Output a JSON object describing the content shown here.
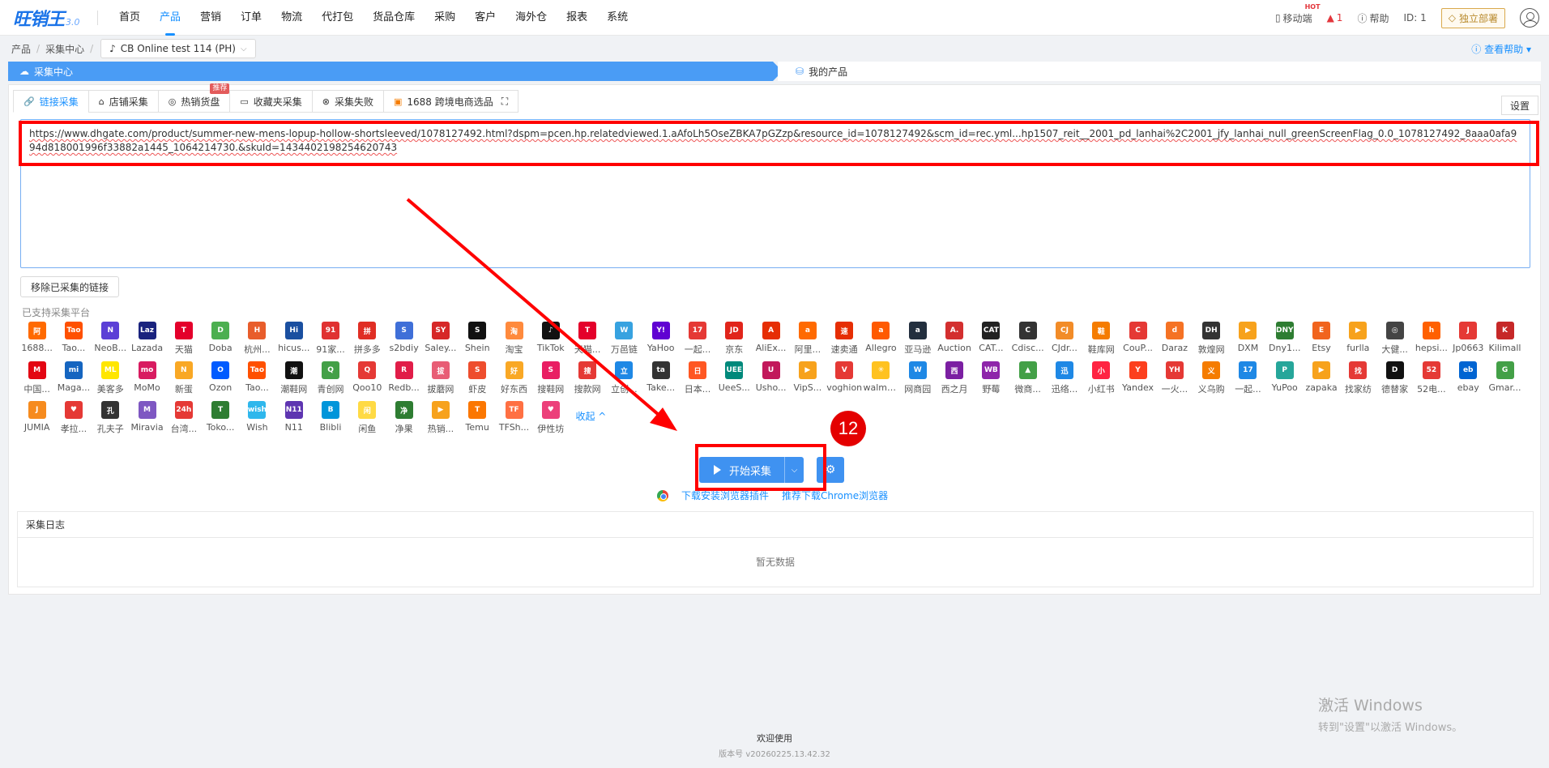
{
  "brand": {
    "name": "旺销王",
    "version": "3.0"
  },
  "nav": {
    "items": [
      "首页",
      "产品",
      "营销",
      "订单",
      "物流",
      "代打包",
      "货品仓库",
      "采购",
      "客户",
      "海外仓",
      "报表",
      "系统"
    ],
    "active": "产品",
    "mobile": "移动端",
    "hot": "HOT",
    "alert_count": "1",
    "help": "帮助",
    "id_label": "ID: 1",
    "deploy": "独立部署"
  },
  "breadcrumb": {
    "items": [
      "产品",
      "采集中心"
    ],
    "shop": "CB Online test 114 (PH)",
    "help_link": "查看帮助"
  },
  "steps": {
    "current": "采集中心",
    "next": "我的产品"
  },
  "tabs": [
    {
      "label": "链接采集",
      "icon": "link-icon"
    },
    {
      "label": "店铺采集",
      "icon": "home-icon"
    },
    {
      "label": "热销货盘",
      "icon": "fire-icon",
      "badge": "推荐"
    },
    {
      "label": "收藏夹采集",
      "icon": "folder-icon"
    },
    {
      "label": "采集失败",
      "icon": "fail-icon"
    },
    {
      "label": "1688 跨境电商选品",
      "icon": "store-icon"
    }
  ],
  "settings_label": "设置",
  "url_input": "https://www.dhgate.com/product/summer-new-mens-lopup-hollow-shortsleeved/1078127492.html?dspm=pcen.hp.relatedviewed.1.aAfoLh5OseZBKA7pGZzp&resource_id=1078127492&scm_id=rec.yml...hp1507_reit__2001_pd_lanhai%2C2001_jfy_lanhai_null_greenScreenFlag_0.0_1078127492_8aaa0afa994d818001996f33882a1445_1064214730.&skuId=1434402198254620743",
  "remove_btn": "移除已采集的链接",
  "supported_label": "已支持采集平台",
  "platforms": [
    {
      "name": "1688...",
      "abbr": "阿",
      "color": "#ff6a00"
    },
    {
      "name": "Tao...",
      "abbr": "Tao",
      "color": "#ff5000"
    },
    {
      "name": "NeoB...",
      "abbr": "N",
      "color": "#5b3fd6"
    },
    {
      "name": "Lazada",
      "abbr": "Laz",
      "color": "#1a237e"
    },
    {
      "name": "天猫",
      "abbr": "T",
      "color": "#e4002b"
    },
    {
      "name": "Doba",
      "abbr": "D",
      "color": "#4caf50"
    },
    {
      "name": "杭州...",
      "abbr": "H",
      "color": "#e85d2b"
    },
    {
      "name": "hicus...",
      "abbr": "Hi",
      "color": "#1a4fa0"
    },
    {
      "name": "91家...",
      "abbr": "91",
      "color": "#e03131"
    },
    {
      "name": "拼多多",
      "abbr": "拼",
      "color": "#e02e24"
    },
    {
      "name": "s2bdiy",
      "abbr": "S",
      "color": "#3f6fd8"
    },
    {
      "name": "Saley...",
      "abbr": "SY",
      "color": "#d62828"
    },
    {
      "name": "Shein",
      "abbr": "S",
      "color": "#111111"
    },
    {
      "name": "淘宝",
      "abbr": "淘",
      "color": "#ff8a3d"
    },
    {
      "name": "TikTok",
      "abbr": "♪",
      "color": "#111111"
    },
    {
      "name": "天猫...",
      "abbr": "T",
      "color": "#e4002b"
    },
    {
      "name": "万邑链",
      "abbr": "W",
      "color": "#37a2e0"
    },
    {
      "name": "YaHoo",
      "abbr": "Y!",
      "color": "#6001d2"
    },
    {
      "name": "一起...",
      "abbr": "17",
      "color": "#e53935"
    },
    {
      "name": "京东",
      "abbr": "JD",
      "color": "#e1251b"
    },
    {
      "name": "AliEx...",
      "abbr": "A",
      "color": "#e62e04"
    },
    {
      "name": "阿里...",
      "abbr": "a",
      "color": "#ff6a00"
    },
    {
      "name": "速卖通",
      "abbr": "速",
      "color": "#e62e04"
    },
    {
      "name": "Allegro",
      "abbr": "a",
      "color": "#ff5a00"
    },
    {
      "name": "亚马逊",
      "abbr": "a",
      "color": "#232f3e"
    },
    {
      "name": "Auction",
      "abbr": "A.",
      "color": "#d32f2f"
    },
    {
      "name": "CAT...",
      "abbr": "CAT",
      "color": "#222222"
    },
    {
      "name": "Cdisc...",
      "abbr": "C",
      "color": "#333333"
    },
    {
      "name": "CJdr...",
      "abbr": "CJ",
      "color": "#f28c28"
    },
    {
      "name": "鞋库网",
      "abbr": "鞋",
      "color": "#f57c00"
    },
    {
      "name": "CouP...",
      "abbr": "C",
      "color": "#e53935"
    },
    {
      "name": "Daraz",
      "abbr": "d",
      "color": "#f57224"
    },
    {
      "name": "敦煌网",
      "abbr": "DH",
      "color": "#333333"
    },
    {
      "name": "DXM",
      "abbr": "▶",
      "color": "#f7a21c"
    },
    {
      "name": "Dny1...",
      "abbr": "DNY",
      "color": "#2e7d32"
    },
    {
      "name": "Etsy",
      "abbr": "E",
      "color": "#f1641e"
    },
    {
      "name": "furlla",
      "abbr": "▶",
      "color": "#f7a21c"
    },
    {
      "name": "大健...",
      "abbr": "◎",
      "color": "#444444"
    },
    {
      "name": "hepsi...",
      "abbr": "h",
      "color": "#ff6000"
    },
    {
      "name": "Jp0663",
      "abbr": "J",
      "color": "#e53935"
    },
    {
      "name": "Kilimall",
      "abbr": "K",
      "color": "#c62828"
    },
    {
      "name": "中国...",
      "abbr": "M",
      "color": "#e30613"
    },
    {
      "name": "Maga...",
      "abbr": "mi",
      "color": "#1565c0"
    },
    {
      "name": "美客多",
      "abbr": "ML",
      "color": "#ffe600"
    },
    {
      "name": "MoMo",
      "abbr": "mo",
      "color": "#d81b60"
    },
    {
      "name": "新蛋",
      "abbr": "N",
      "color": "#f9a825"
    },
    {
      "name": "Ozon",
      "abbr": "O",
      "color": "#005bff"
    },
    {
      "name": "Tao...",
      "abbr": "Tao",
      "color": "#ff5000"
    },
    {
      "name": "潮鞋网",
      "abbr": "潮",
      "color": "#111111"
    },
    {
      "name": "青创网",
      "abbr": "Q",
      "color": "#43a047"
    },
    {
      "name": "Qoo10",
      "abbr": "Q",
      "color": "#e53935"
    },
    {
      "name": "Redb...",
      "abbr": "R",
      "color": "#e11d48"
    },
    {
      "name": "拔蘑网",
      "abbr": "拔",
      "color": "#e85d75"
    },
    {
      "name": "虾皮",
      "abbr": "S",
      "color": "#ee4d2d"
    },
    {
      "name": "好东西",
      "abbr": "好",
      "color": "#f9a825"
    },
    {
      "name": "搜鞋网",
      "abbr": "S",
      "color": "#e91e63"
    },
    {
      "name": "搜款网",
      "abbr": "搜",
      "color": "#e53935"
    },
    {
      "name": "立创...",
      "abbr": "立",
      "color": "#1e88e5"
    },
    {
      "name": "Take...",
      "abbr": "ta",
      "color": "#333333"
    },
    {
      "name": "日本...",
      "abbr": "日",
      "color": "#ff5722"
    },
    {
      "name": "UeeS...",
      "abbr": "UEE",
      "color": "#00897b"
    },
    {
      "name": "Usho...",
      "abbr": "U",
      "color": "#c2185b"
    },
    {
      "name": "VipS...",
      "abbr": "▶",
      "color": "#f7a21c"
    },
    {
      "name": "voghion",
      "abbr": "V",
      "color": "#e53935"
    },
    {
      "name": "walmart",
      "abbr": "✳",
      "color": "#ffc220"
    },
    {
      "name": "网商园",
      "abbr": "W",
      "color": "#1e88e5"
    },
    {
      "name": "西之月",
      "abbr": "西",
      "color": "#7b1fa2"
    },
    {
      "name": "野莓",
      "abbr": "WB",
      "color": "#8e24aa"
    },
    {
      "name": "微商...",
      "abbr": "▲",
      "color": "#43a047"
    },
    {
      "name": "迅络...",
      "abbr": "迅",
      "color": "#1e88e5"
    },
    {
      "name": "小红书",
      "abbr": "小",
      "color": "#ff2442"
    },
    {
      "name": "Yandex",
      "abbr": "Y",
      "color": "#fc3f1d"
    },
    {
      "name": "一火...",
      "abbr": "YH",
      "color": "#e53935"
    },
    {
      "name": "义乌购",
      "abbr": "义",
      "color": "#f57c00"
    },
    {
      "name": "一起...",
      "abbr": "17",
      "color": "#1e88e5"
    },
    {
      "name": "YuPoo",
      "abbr": "P",
      "color": "#26a69a"
    },
    {
      "name": "zapaka",
      "abbr": "▶",
      "color": "#f7a21c"
    },
    {
      "name": "找家纺",
      "abbr": "找",
      "color": "#e53935"
    },
    {
      "name": "德替家",
      "abbr": "D",
      "color": "#111111"
    },
    {
      "name": "52电...",
      "abbr": "52",
      "color": "#e53935"
    },
    {
      "name": "ebay",
      "abbr": "eb",
      "color": "#0064d2"
    },
    {
      "name": "Gmar...",
      "abbr": "G",
      "color": "#43a047"
    },
    {
      "name": "JUMIA",
      "abbr": "J",
      "color": "#f68b1e"
    },
    {
      "name": "孝拉...",
      "abbr": "♥",
      "color": "#e53935"
    },
    {
      "name": "孔夫子",
      "abbr": "孔",
      "color": "#333333"
    },
    {
      "name": "Miravia",
      "abbr": "M",
      "color": "#7e57c2"
    },
    {
      "name": "台湾...",
      "abbr": "24h",
      "color": "#e53935"
    },
    {
      "name": "Toko...",
      "abbr": "T",
      "color": "#2e7d32"
    },
    {
      "name": "Wish",
      "abbr": "wish",
      "color": "#2fb7ec"
    },
    {
      "name": "N11",
      "abbr": "N11",
      "color": "#5e35b1"
    },
    {
      "name": "Blibli",
      "abbr": "B",
      "color": "#0095da"
    },
    {
      "name": "闲鱼",
      "abbr": "闲",
      "color": "#ffda44"
    },
    {
      "name": "净果",
      "abbr": "净",
      "color": "#2e7d32"
    },
    {
      "name": "热销...",
      "abbr": "▶",
      "color": "#f7a21c"
    },
    {
      "name": "Temu",
      "abbr": "T",
      "color": "#fb7701"
    },
    {
      "name": "TFSh...",
      "abbr": "TF",
      "color": "#ff7043"
    },
    {
      "name": "伊性坊",
      "abbr": "♥",
      "color": "#ec407a"
    }
  ],
  "collapse_label": "收起 ^",
  "start_btn": "开始采集",
  "step_number": "12",
  "download_links": [
    "下载安装浏览器插件",
    "推荐下载Chrome浏览器"
  ],
  "log": {
    "title": "采集日志",
    "empty": "暂无数据"
  },
  "footer": {
    "welcome": "欢迎使用",
    "version": "版本号 v20260225.13.42.32"
  },
  "watermark": {
    "line1": "激活 Windows",
    "line2": "转到\"设置\"以激活 Windows。"
  },
  "colors": {
    "accent": "#1890ff",
    "annotation_red": "#ff0000",
    "step_bar": "#4a9cf5"
  }
}
